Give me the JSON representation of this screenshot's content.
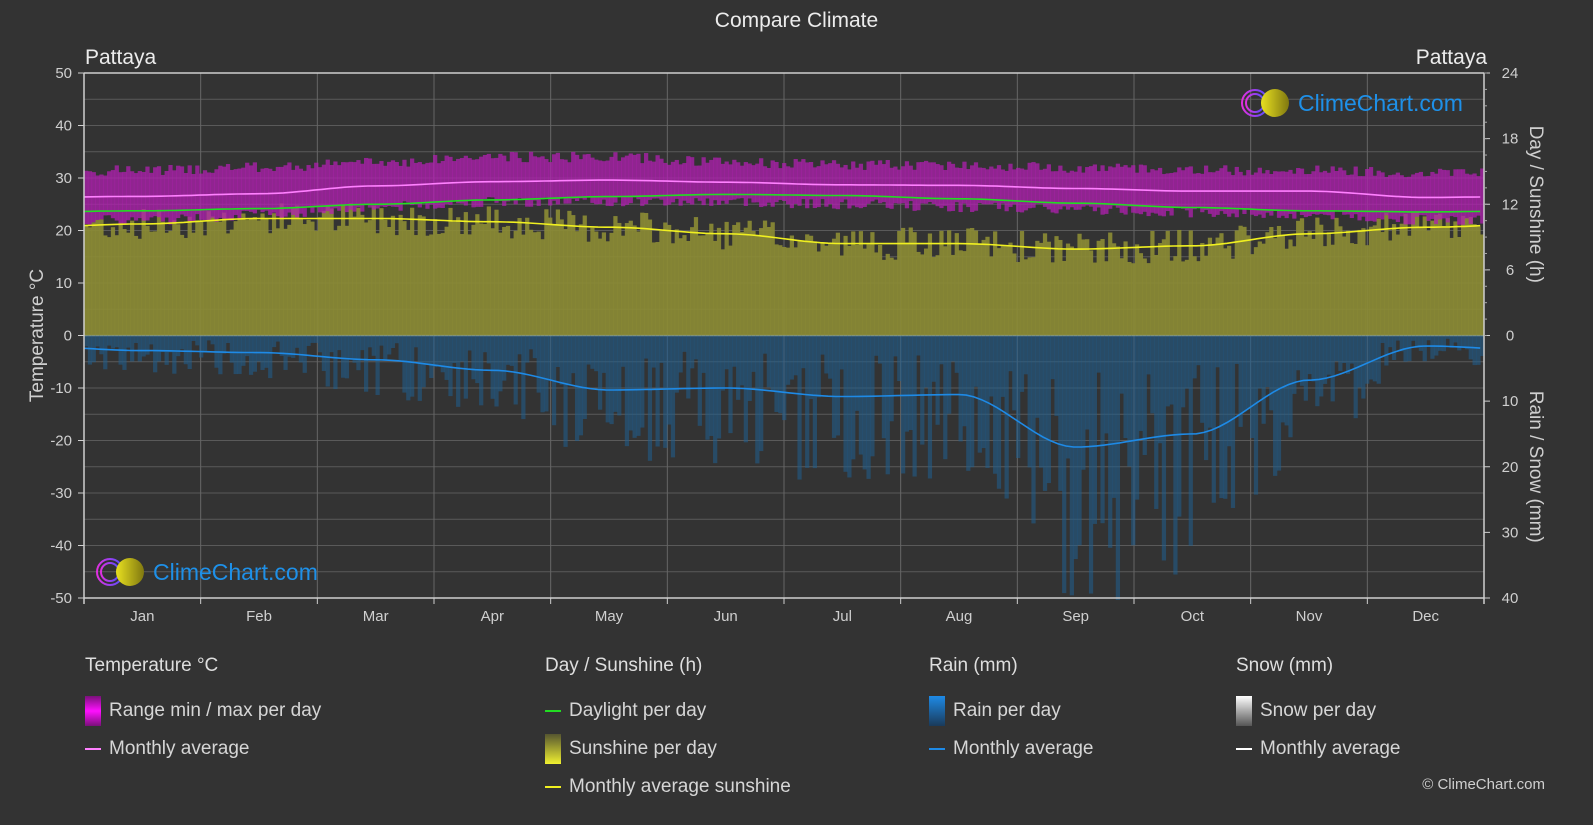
{
  "title": "Compare Climate",
  "location_left": "Pattaya",
  "location_right": "Pattaya",
  "logo_text": "ClimeChart.com",
  "copyright": "© ClimeChart.com",
  "colors": {
    "background": "#333333",
    "temp_range": "#c020c0",
    "temp_avg": "#ff80ff",
    "daylight": "#22dd22",
    "sunshine_fill": "#8c8c34",
    "sunshine_avg": "#f0f020",
    "rain_fill": "#1f5f8f",
    "rain_avg": "#1e8ae6",
    "snow_avg": "#ffffff",
    "logo_text": "#1e90e8"
  },
  "legend": {
    "temperature": {
      "title": "Temperature °C",
      "items": [
        "Range min / max per day",
        "Monthly average"
      ]
    },
    "sunshine": {
      "title": "Day / Sunshine (h)",
      "items": [
        "Daylight per day",
        "Sunshine per day",
        "Monthly average sunshine"
      ]
    },
    "rain": {
      "title": "Rain (mm)",
      "items": [
        "Rain per day",
        "Monthly average"
      ]
    },
    "snow": {
      "title": "Snow (mm)",
      "items": [
        "Snow per day",
        "Monthly average"
      ]
    }
  },
  "chart_data": {
    "type": "line",
    "title": "Compare Climate",
    "categories": [
      "Jan",
      "Feb",
      "Mar",
      "Apr",
      "May",
      "Jun",
      "Jul",
      "Aug",
      "Sep",
      "Oct",
      "Nov",
      "Dec"
    ],
    "y_left": {
      "label": "Temperature °C",
      "range": [
        -50,
        50
      ],
      "ticks": [
        50,
        40,
        30,
        20,
        10,
        0,
        -10,
        -20,
        -30,
        -40,
        -50
      ]
    },
    "y_right_top": {
      "label": "Day / Sunshine (h)",
      "range": [
        0,
        24
      ],
      "ticks": [
        24,
        18,
        12,
        6,
        0
      ]
    },
    "y_right_bottom": {
      "label": "Rain / Snow (mm)",
      "range": [
        0,
        40
      ],
      "ticks": [
        0,
        10,
        20,
        30,
        40
      ]
    },
    "grid": true,
    "series": [
      {
        "name": "Temperature monthly average (°C)",
        "axis": "left",
        "values": [
          26.5,
          27.0,
          28.5,
          29.3,
          29.6,
          29.2,
          28.7,
          28.6,
          28.0,
          27.5,
          27.5,
          26.3
        ]
      },
      {
        "name": "Temperature daily max (approx °C)",
        "axis": "left",
        "values": [
          31.5,
          32,
          33,
          34,
          34,
          33,
          32.5,
          32.5,
          32,
          31.5,
          31.5,
          31
        ]
      },
      {
        "name": "Temperature daily min (approx °C)",
        "axis": "left",
        "values": [
          22,
          23,
          24.5,
          25.5,
          25.5,
          25.5,
          25,
          24.5,
          24,
          23.5,
          23,
          22
        ]
      },
      {
        "name": "Daylight per day (h)",
        "axis": "right_top",
        "values": [
          11.4,
          11.6,
          12.0,
          12.4,
          12.7,
          12.9,
          12.8,
          12.5,
          12.1,
          11.7,
          11.4,
          11.3
        ]
      },
      {
        "name": "Monthly average sunshine (h)",
        "axis": "right_top",
        "values": [
          10.2,
          10.7,
          10.7,
          10.4,
          9.9,
          9.3,
          8.4,
          8.4,
          7.9,
          8.2,
          9.3,
          9.9
        ]
      },
      {
        "name": "Rain monthly average (mm)",
        "axis": "right_bottom",
        "values": [
          2.3,
          2.6,
          3.7,
          5.3,
          8.3,
          8.0,
          9.3,
          9.0,
          17.0,
          15.0,
          6.8,
          1.6
        ]
      },
      {
        "name": "Snow monthly average (mm)",
        "axis": "right_bottom",
        "values": [
          0,
          0,
          0,
          0,
          0,
          0,
          0,
          0,
          0,
          0,
          0,
          0
        ]
      }
    ]
  }
}
